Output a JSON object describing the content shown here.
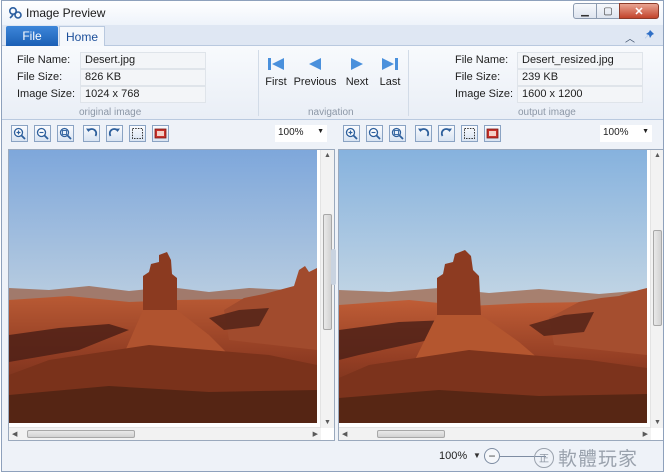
{
  "window": {
    "title": "Image Preview"
  },
  "tabs": {
    "file": "File",
    "home": "Home"
  },
  "original": {
    "group_label": "original image",
    "file_name_label": "File Name:",
    "file_name": "Desert.jpg",
    "file_size_label": "File Size:",
    "file_size": "826 KB",
    "image_size_label": "Image Size:",
    "image_size": "1024 x 768"
  },
  "navigation": {
    "group_label": "navigation",
    "first": "First",
    "previous": "Previous",
    "next": "Next",
    "last": "Last"
  },
  "output": {
    "group_label": "output image",
    "file_name_label": "File Name:",
    "file_name": "Desert_resized.jpg",
    "file_size_label": "File Size:",
    "file_size": "239 KB",
    "image_size_label": "Image Size:",
    "image_size": "1600 x 1200"
  },
  "left_pane": {
    "zoom": "100%"
  },
  "right_pane": {
    "zoom": "100%"
  },
  "statusbar": {
    "zoom": "100%",
    "watermark": "軟體玩家",
    "watermark_mark": "正"
  },
  "colors": {
    "file_tab": "#1b5fb5",
    "nav_icon": "#4a90dc",
    "sky_top": "#7fa8dc",
    "rock": "#a8462a"
  },
  "icons": [
    "app-icon",
    "pin-icon",
    "zoom-in-icon",
    "zoom-out-icon",
    "zoom-fit-icon",
    "rotate-left-icon",
    "rotate-right-icon",
    "select-icon",
    "compare-icon"
  ]
}
